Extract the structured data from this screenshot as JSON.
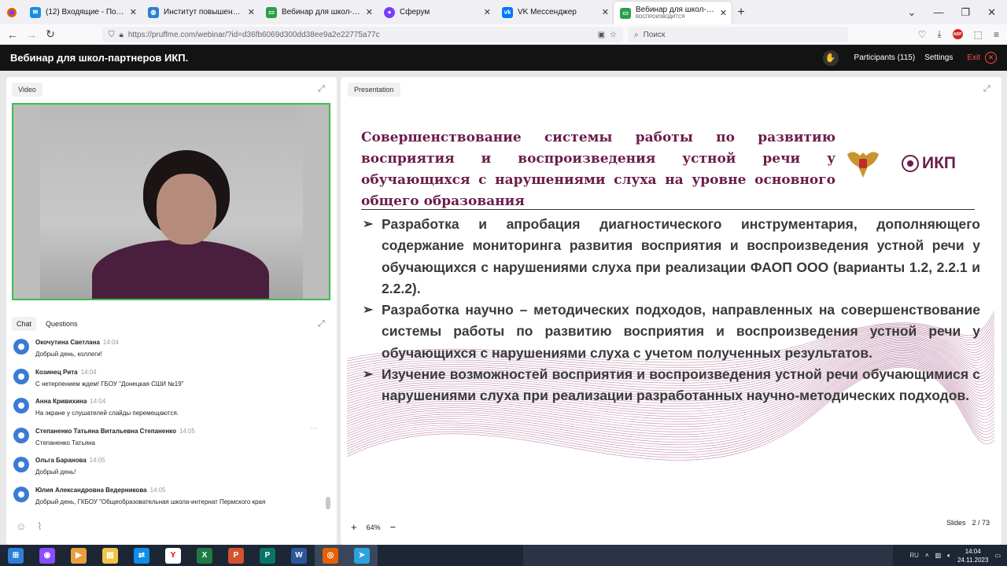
{
  "browser": {
    "tabs": [
      {
        "title": "(12) Входящие - Почта Mail.ru",
        "color": "#168de2",
        "icon": "mail-icon"
      },
      {
        "title": "Институт повышения квалиф...",
        "color": "#2b7fd1",
        "icon": "globe-icon"
      },
      {
        "title": "Вебинар для школ-партнеров",
        "color": "#27a04a",
        "icon": "webinar-icon"
      },
      {
        "title": "Сферум",
        "color": "#7a3cff",
        "icon": "sferum-icon"
      },
      {
        "title": "VK Мессенджер",
        "color": "#0077ff",
        "icon": "vk-icon"
      }
    ],
    "active_tab": {
      "title": "Вебинар для школ-партнеров",
      "subtitle": "ВОСПРОИЗВОДИТСЯ"
    },
    "url": {
      "host": "https://pruffme.com",
      "path": "/webinar/?id=d36fb6069d300dd38ee9a2e22775a77c"
    },
    "search_placeholder": "Поиск",
    "abp_label": "ABP"
  },
  "app": {
    "title": "Вебинар для школ-партнеров ИКП.",
    "participants": "Participants (115)",
    "settings": "Settings",
    "exit": "Exit"
  },
  "video": {
    "tab_label": "Video"
  },
  "chat": {
    "tabs": [
      "Chat",
      "Questions"
    ],
    "messages": [
      {
        "name": "Окочутина Светлана",
        "time": "14:04",
        "text": "Добрый день, коллеги!"
      },
      {
        "name": "Козинец Рита",
        "time": "14:04",
        "text": "С нетерпением ждем! ГБОУ \"Донецкая СШИ №19\""
      },
      {
        "name": "Анна Кривихина",
        "time": "14:04",
        "text": "На экране у слушателей слайды перемещаются."
      },
      {
        "name": "Степаненко Татьяна Витальевна Степаненко",
        "time": "14:05",
        "text": "Степаненко Татьяна"
      },
      {
        "name": "Ольга Баранова",
        "time": "14:05",
        "text": "Добрый день!"
      },
      {
        "name": "Юлия Александровна Ведерникова",
        "time": "14:05",
        "text": "Добрый день, ГКБОУ \"Общеобразовательная школа-интернат Пермского края"
      }
    ]
  },
  "presentation": {
    "tab_label": "Presentation",
    "slide": {
      "title": "Совершенствование системы работы по развитию восприятия и воспроизведения устной речи у обучающихся с нарушениями слуха на уровне основного общего образования",
      "logo_text": "ИКП",
      "bullets": [
        "Разработка и апробация диагностического инструментария, дополняющего содержание мониторинга развития восприятия и воспроизведения устной речи у обучающихся с нарушениями слуха при реализации ФАОП ООО (варианты 1.2, 2.2.1 и 2.2.2).",
        "Разработка научно – методических подходов, направленных на совершенствование системы работы по развитию восприятия и воспроизведения устной речи у обучающихся с нарушениями слуха с учетом полученных результатов.",
        "Изучение возможностей восприятия и воспроизведения устной речи обучающимися с нарушениями слуха при реализации разработанных научно-методических подходов."
      ]
    },
    "zoom": "64%",
    "slides_label": "Slides",
    "slides_counter": "2 / 73"
  },
  "taskbar": {
    "apps": [
      {
        "name": "start-icon",
        "color": "#2d7fd8",
        "glyph": "⊞"
      },
      {
        "name": "alisa-icon",
        "color": "#8a4dff",
        "glyph": "◉"
      },
      {
        "name": "media-player-icon",
        "color": "#e8a13a",
        "glyph": "▶"
      },
      {
        "name": "file-explorer-icon",
        "color": "#f0c34a",
        "glyph": "▤"
      },
      {
        "name": "teamviewer-icon",
        "color": "#0e8ee9",
        "glyph": "⇄"
      },
      {
        "name": "yandex-browser-icon",
        "color": "#ffffff",
        "glyph": "Y"
      },
      {
        "name": "excel-icon",
        "color": "#1f7a45",
        "glyph": "X"
      },
      {
        "name": "powerpoint-icon",
        "color": "#d35230",
        "glyph": "P"
      },
      {
        "name": "publisher-icon",
        "color": "#077568",
        "glyph": "P"
      },
      {
        "name": "word-icon",
        "color": "#2b579a",
        "glyph": "W"
      },
      {
        "name": "firefox-icon",
        "color": "#e66000",
        "glyph": "◎"
      },
      {
        "name": "telegram-icon",
        "color": "#2aa3df",
        "glyph": "➤"
      }
    ],
    "lang": "RU",
    "time": "14:04",
    "date": "24.11.2023"
  }
}
